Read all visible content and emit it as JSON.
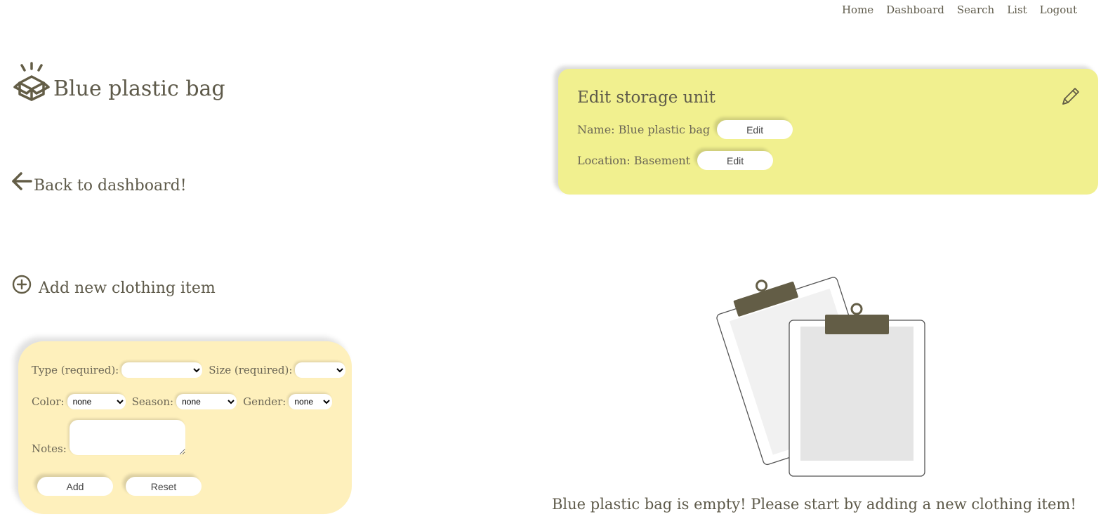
{
  "nav": {
    "links": [
      "Home",
      "Dashboard",
      "Search",
      "List",
      "Logout"
    ]
  },
  "page": {
    "title": "Blue plastic bag",
    "title_icon": "open-box-icon",
    "back_label": "Back to dashboard!",
    "back_icon": "arrow-left-icon",
    "add_new_label": "Add new clothing item",
    "add_new_icon": "plus-circle-icon"
  },
  "add_form": {
    "type_label": "Type (required):",
    "type_value": "",
    "size_label": "Size (required):",
    "size_value": "",
    "color_label": "Color:",
    "color_value": "none",
    "season_label": "Season:",
    "season_value": "none",
    "gender_label": "Gender:",
    "gender_value": "none",
    "notes_label": "Notes:",
    "notes_value": "",
    "add_label": "Add",
    "reset_label": "Reset",
    "background": "#fef0bc"
  },
  "edit_card": {
    "title": "Edit storage unit",
    "name_text": "Name: Blue plastic bag",
    "location_text": "Location: Basement",
    "edit_label": "Edit",
    "icon": "pencil-icon",
    "background": "#f1f08f"
  },
  "empty_state": {
    "illustration": "clipboards-illustration",
    "message": "Blue plastic bag is empty! Please start by adding a new clothing item!"
  },
  "colors": {
    "text": "#5e5a4a",
    "accent_dark": "#635d46"
  }
}
